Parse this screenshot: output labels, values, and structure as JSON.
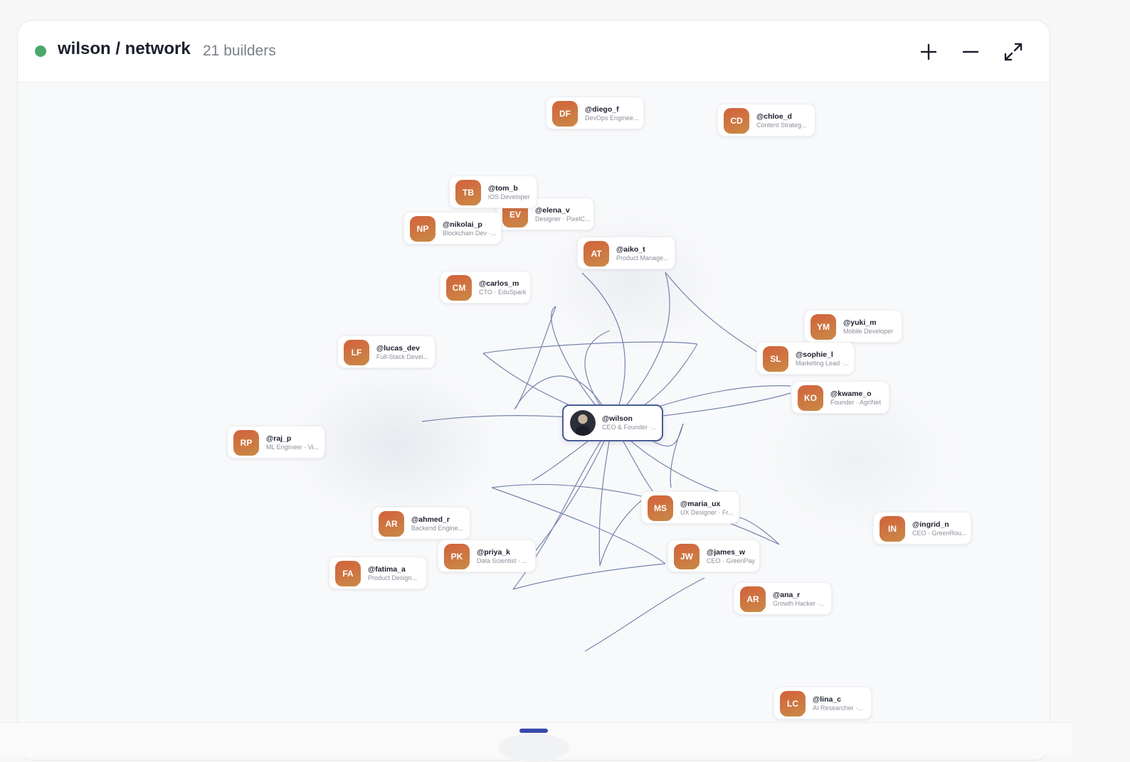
{
  "header": {
    "title": "wilson / network",
    "count": "21 builders",
    "status_color": "#4aa86b"
  },
  "controls": {
    "zoom_in_icon": "plus-icon",
    "zoom_out_icon": "minus-icon",
    "expand_icon": "expand-icon"
  },
  "center": {
    "username": "@wilson",
    "role": "CEO & Founder ·..."
  },
  "nodes": [
    {
      "initials": "DF",
      "username": "@diego_f",
      "role": "DevOps Enginee..."
    },
    {
      "initials": "CD",
      "username": "@chloe_d",
      "role": "Content Strateg..."
    },
    {
      "initials": "TB",
      "username": "@tom_b",
      "role": "iOS Developer"
    },
    {
      "initials": "EV",
      "username": "@elena_v",
      "role": "Designer · PixelC..."
    },
    {
      "initials": "NP",
      "username": "@nikolai_p",
      "role": "Blockchain Dev ·..."
    },
    {
      "initials": "AT",
      "username": "@aiko_t",
      "role": "Product Manage..."
    },
    {
      "initials": "CM",
      "username": "@carlos_m",
      "role": "CTO · EduSpark"
    },
    {
      "initials": "LF",
      "username": "@lucas_dev",
      "role": "Full-Stack Devel..."
    },
    {
      "initials": "YM",
      "username": "@yuki_m",
      "role": "Mobile Developer"
    },
    {
      "initials": "SL",
      "username": "@sophie_l",
      "role": "Marketing Lead ·..."
    },
    {
      "initials": "KO",
      "username": "@kwame_o",
      "role": "Founder · AgriNet"
    },
    {
      "initials": "RP",
      "username": "@raj_p",
      "role": "ML Engineer · Vi..."
    },
    {
      "initials": "MS",
      "username": "@maria_ux",
      "role": "UX Designer · Fr..."
    },
    {
      "initials": "AR",
      "username": "@ahmed_r",
      "role": "Backend Engine..."
    },
    {
      "initials": "IN",
      "username": "@ingrid_n",
      "role": "CEO · GreenRou..."
    },
    {
      "initials": "PK",
      "username": "@priya_k",
      "role": "Data Scientist · ..."
    },
    {
      "initials": "JW",
      "username": "@james_w",
      "role": "CEO · GreenPay"
    },
    {
      "initials": "FA",
      "username": "@fatima_a",
      "role": "Product Design..."
    },
    {
      "initials": "AR",
      "username": "@ana_r",
      "role": "Growth Hacker ·..."
    },
    {
      "initials": "LC",
      "username": "@lina_c",
      "role": "AI Researcher ·..."
    }
  ]
}
